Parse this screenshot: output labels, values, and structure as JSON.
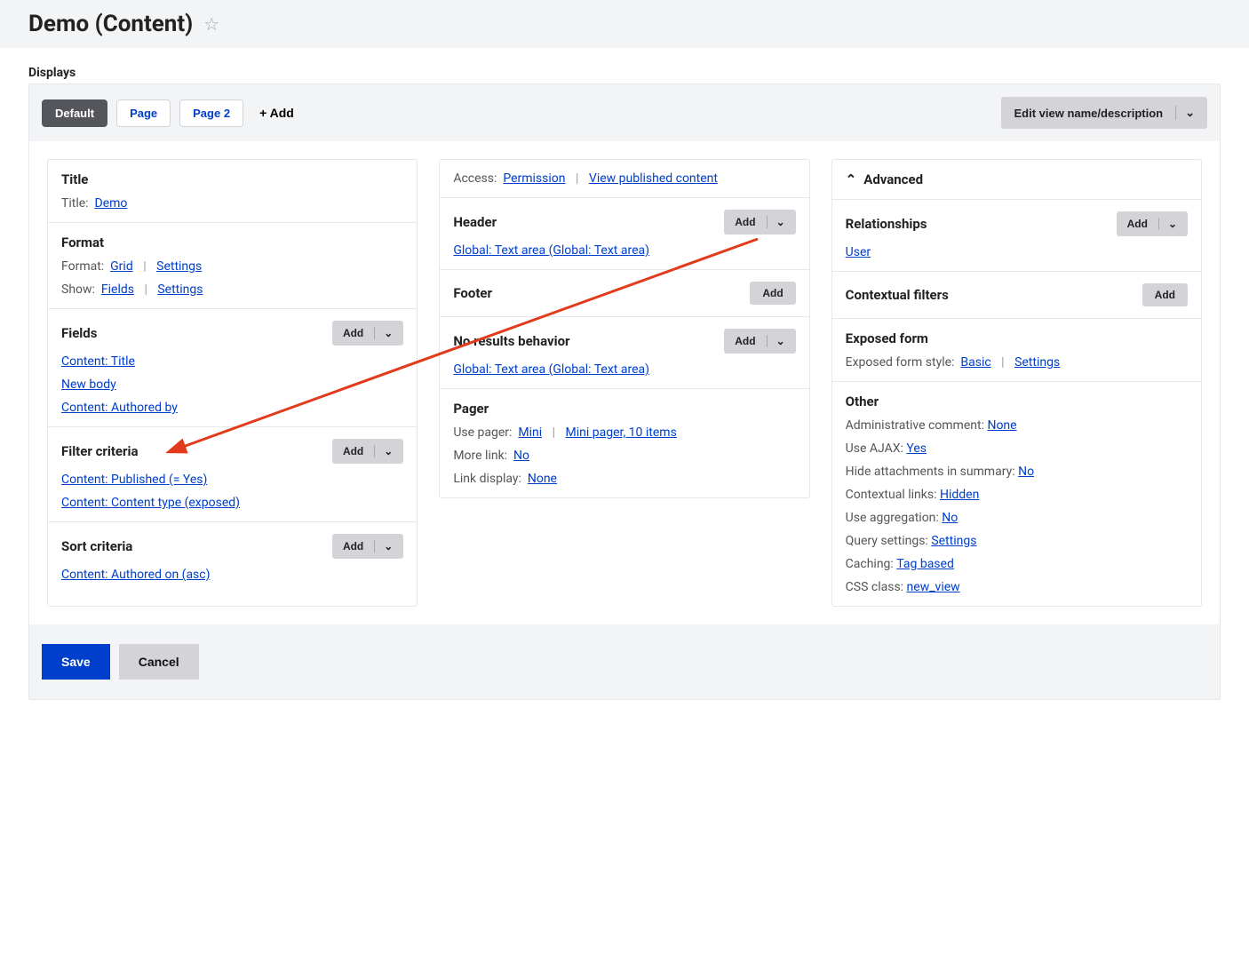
{
  "header": {
    "title": "Demo (Content)"
  },
  "displays_label": "Displays",
  "tabs": [
    {
      "label": "Default",
      "active": true
    },
    {
      "label": "Page",
      "active": false
    },
    {
      "label": "Page 2",
      "active": false
    }
  ],
  "add_tab_label": "+ Add",
  "edit_view_button": "Edit view name/description",
  "col1": {
    "title_section": {
      "heading": "Title",
      "label": "Title:",
      "value": "Demo"
    },
    "format_section": {
      "heading": "Format",
      "format_label": "Format:",
      "format_value": "Grid",
      "format_settings": "Settings",
      "show_label": "Show:",
      "show_value": "Fields",
      "show_settings": "Settings"
    },
    "fields_section": {
      "heading": "Fields",
      "add": "Add",
      "items": [
        "Content: Title",
        "New body",
        "Content: Authored by"
      ]
    },
    "filter_section": {
      "heading": "Filter criteria",
      "add": "Add",
      "items": [
        "Content: Published (= Yes)",
        "Content: Content type (exposed)"
      ]
    },
    "sort_section": {
      "heading": "Sort criteria",
      "add": "Add",
      "items": [
        "Content: Authored on (asc)"
      ]
    }
  },
  "col2": {
    "access": {
      "label": "Access:",
      "perm": "Permission",
      "value": "View published content"
    },
    "header": {
      "heading": "Header",
      "add": "Add",
      "items": [
        "Global: Text area (Global: Text area)"
      ]
    },
    "footer": {
      "heading": "Footer",
      "add": "Add"
    },
    "nores": {
      "heading": "No results behavior",
      "add": "Add",
      "items": [
        "Global: Text area (Global: Text area)"
      ]
    },
    "pager": {
      "heading": "Pager",
      "use_pager_label": "Use pager:",
      "use_pager_value": "Mini",
      "use_pager_detail": "Mini pager, 10 items",
      "more_label": "More link:",
      "more_value": "No",
      "linkd_label": "Link display:",
      "linkd_value": "None"
    }
  },
  "col3": {
    "advanced": "Advanced",
    "relationships": {
      "heading": "Relationships",
      "add": "Add",
      "items": [
        "User"
      ]
    },
    "contextual": {
      "heading": "Contextual filters",
      "add": "Add"
    },
    "exposed": {
      "heading": "Exposed form",
      "label": "Exposed form style:",
      "value": "Basic",
      "settings": "Settings"
    },
    "other": {
      "heading": "Other",
      "rows": [
        {
          "label": "Administrative comment:",
          "value": "None"
        },
        {
          "label": "Use AJAX:",
          "value": "Yes"
        },
        {
          "label": "Hide attachments in summary:",
          "value": "No"
        },
        {
          "label": "Contextual links:",
          "value": "Hidden"
        },
        {
          "label": "Use aggregation:",
          "value": "No"
        },
        {
          "label": "Query settings:",
          "value": "Settings"
        },
        {
          "label": "Caching:",
          "value": "Tag based"
        },
        {
          "label": "CSS class:",
          "value": "new_view"
        }
      ]
    }
  },
  "buttons": {
    "save": "Save",
    "cancel": "Cancel"
  }
}
